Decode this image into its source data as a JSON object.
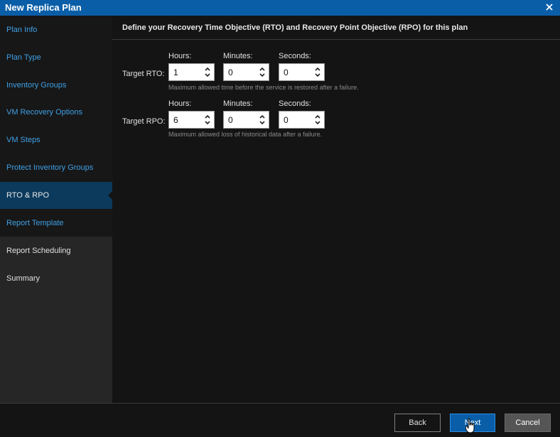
{
  "window": {
    "title": "New Replica Plan"
  },
  "sidebar": {
    "items": [
      {
        "label": "Plan Info",
        "state": "visited"
      },
      {
        "label": "Plan Type",
        "state": "visited"
      },
      {
        "label": "Inventory Groups",
        "state": "visited"
      },
      {
        "label": "VM Recovery Options",
        "state": "visited"
      },
      {
        "label": "VM Steps",
        "state": "visited"
      },
      {
        "label": "Protect Inventory Groups",
        "state": "visited"
      },
      {
        "label": "RTO & RPO",
        "state": "active"
      },
      {
        "label": "Report Template",
        "state": "visited"
      },
      {
        "label": "Report Scheduling",
        "state": "upcoming"
      },
      {
        "label": "Summary",
        "state": "upcoming"
      }
    ]
  },
  "main": {
    "heading": "Define your Recovery Time Objective (RTO) and Recovery Point Objective (RPO) for this plan",
    "rto": {
      "label": "Target RTO:",
      "hours_label": "Hours:",
      "minutes_label": "Minutes:",
      "seconds_label": "Seconds:",
      "hours": "1",
      "minutes": "0",
      "seconds": "0",
      "hint": "Maximum allowed time before the service is restored after a failure."
    },
    "rpo": {
      "label": "Target RPO:",
      "hours_label": "Hours:",
      "minutes_label": "Minutes:",
      "seconds_label": "Seconds:",
      "hours": "6",
      "minutes": "0",
      "seconds": "0",
      "hint": "Maximum allowed loss of historical data after a failure."
    }
  },
  "footer": {
    "back_label": "Back",
    "next_label": "Next",
    "cancel_label": "Cancel"
  },
  "colors": {
    "accent": "#0a5ea8",
    "visited_link": "#3fa0e6",
    "active_item": "#0b3a5c"
  },
  "icons": {
    "close": "close-icon",
    "spin": "chevron-up-down-icon",
    "cursor": "hand-pointer-icon"
  }
}
